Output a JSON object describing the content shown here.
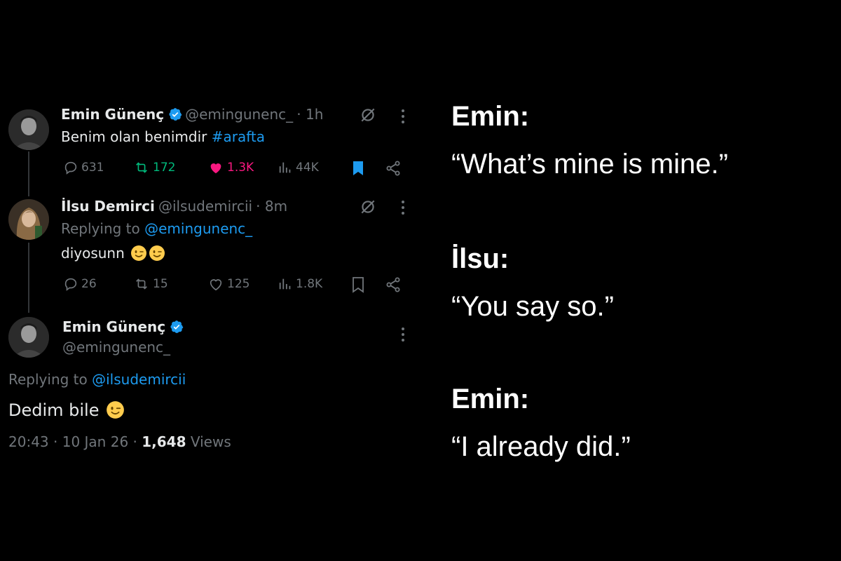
{
  "tweet1": {
    "name": "Emin Günenç",
    "handle": "@emingunenc_",
    "time": "· 1h",
    "text": "Benim olan benimdir ",
    "hashtag": "#arafta",
    "replies": "631",
    "retweets": "172",
    "likes": "1.3K",
    "views": "44K",
    "colors": {
      "retweet": "#00ba7c",
      "like": "#f91880",
      "bookmark": "#1d9bf0"
    }
  },
  "tweet2": {
    "name": "İlsu Demirci",
    "handle": "@ilsudemircii",
    "time": "· 8m",
    "replying_prefix": "Replying to ",
    "replying_to": "@emingunenc_",
    "text": "diyosunn",
    "emoji": "winking-face-emoji",
    "replies": "26",
    "retweets": "15",
    "likes": "125",
    "views": "1.8K"
  },
  "tweet3": {
    "name": "Emin Günenç",
    "handle": "@emingunenc_",
    "replying_prefix": "Replying to ",
    "replying_to": "@ilsudemircii",
    "text": "Dedim bile",
    "emoji": "winking-face-emoji",
    "time": "20:43",
    "date": "10 Jan 26",
    "views_count": "1,648",
    "views_label": "Views"
  },
  "translation": [
    {
      "speaker": "Emin:",
      "quote": "“What’s mine is mine.”"
    },
    {
      "speaker": "İlsu:",
      "quote": "“You say so.”"
    },
    {
      "speaker": "Emin:",
      "quote": "“I already did.”"
    }
  ],
  "icons": [
    "reply-icon",
    "retweet-icon",
    "like-icon",
    "views-icon",
    "bookmark-icon",
    "share-icon",
    "grok-icon",
    "more-icon",
    "verified-icon"
  ]
}
